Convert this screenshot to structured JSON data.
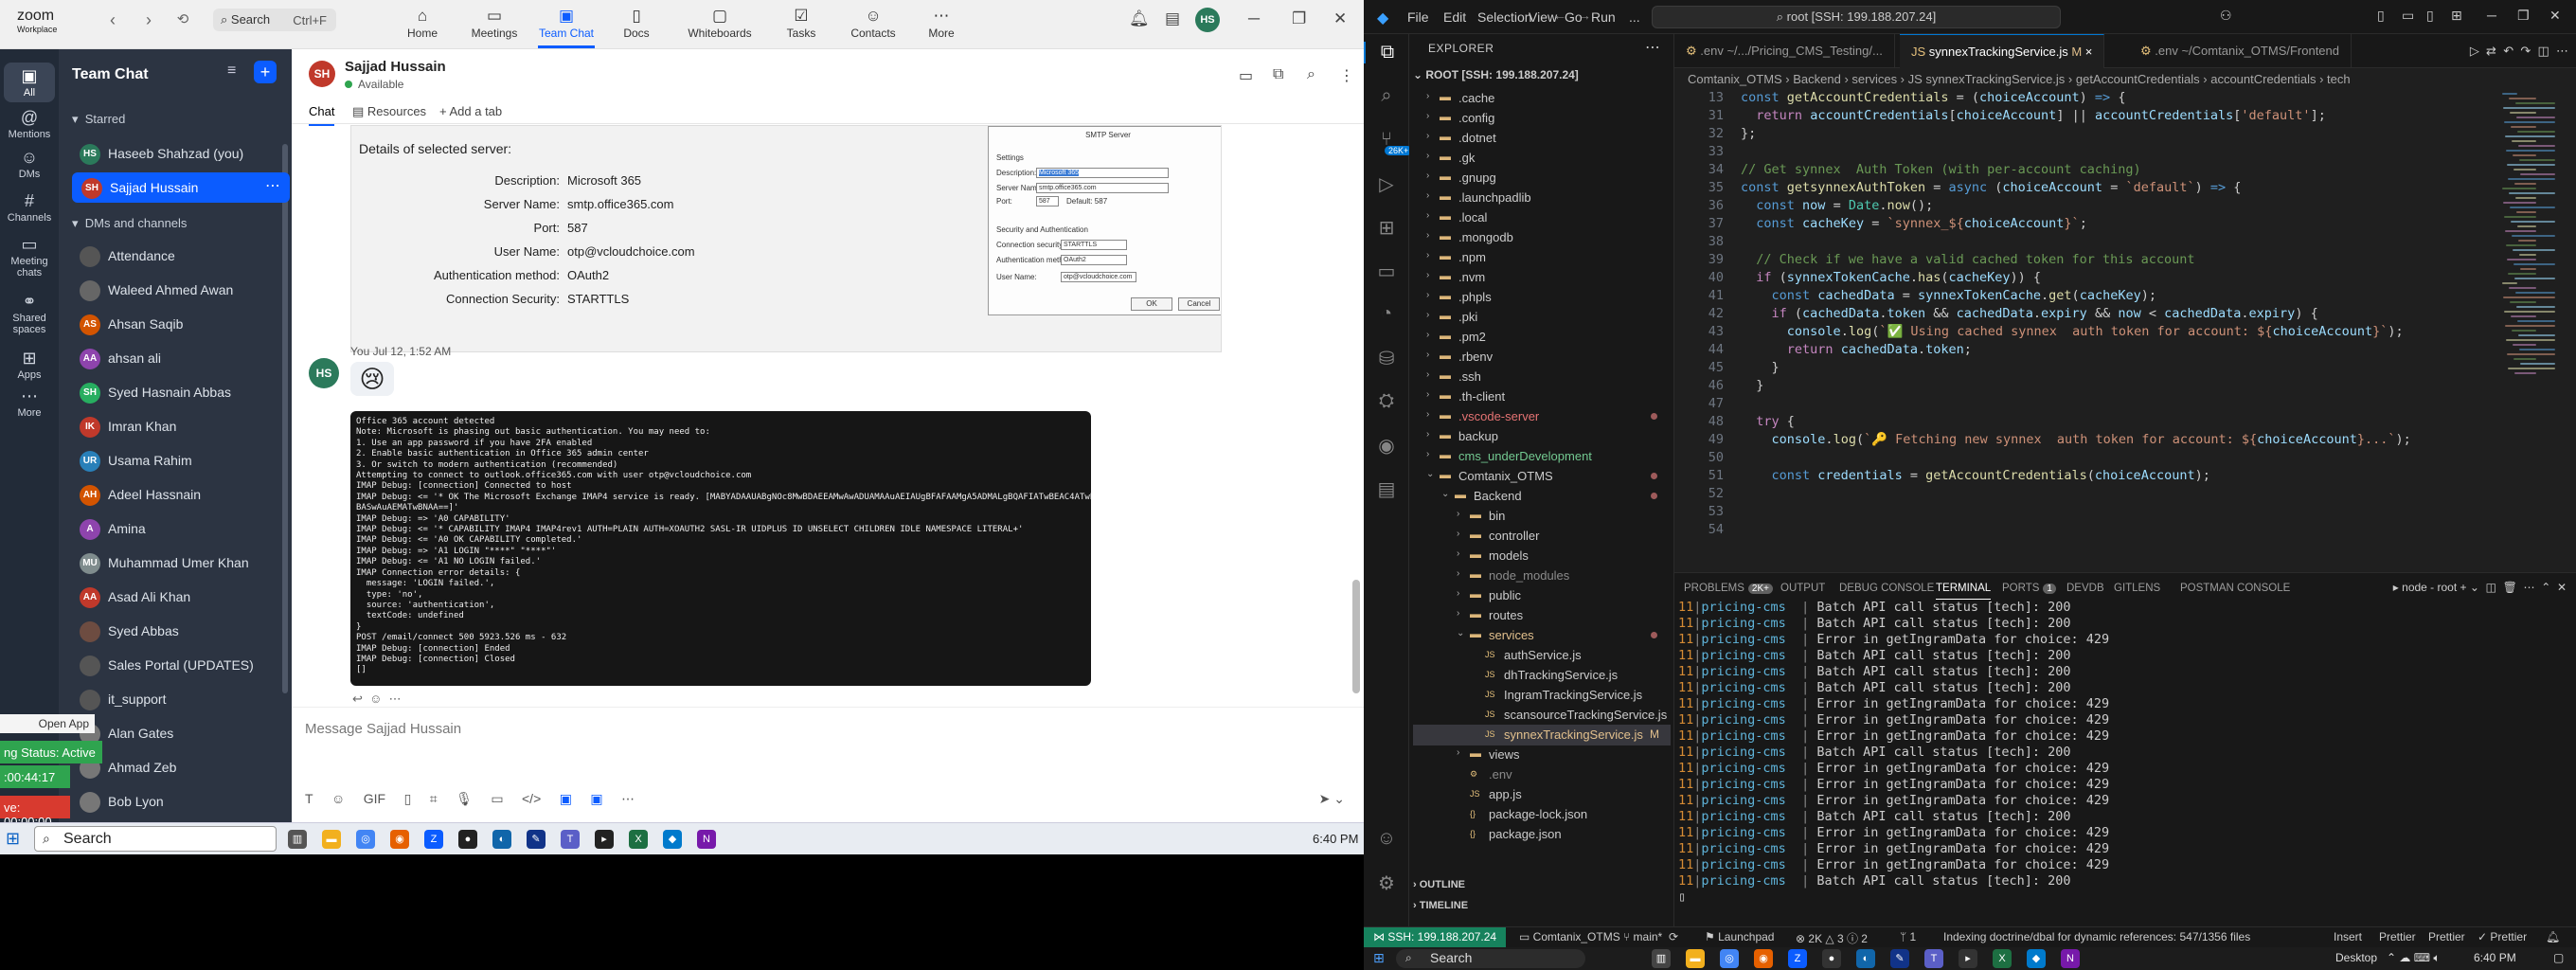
{
  "zoom": {
    "logo_top": "zoom",
    "logo_bottom": "Workplace",
    "search_label": "Search",
    "search_shortcut": "Ctrl+F",
    "tabs": [
      {
        "label": "Home",
        "icon": "home-icon"
      },
      {
        "label": "Meetings",
        "icon": "meetings-icon"
      },
      {
        "label": "Team Chat",
        "icon": "chat-icon"
      },
      {
        "label": "Docs",
        "icon": "docs-icon"
      },
      {
        "label": "Whiteboards",
        "icon": "whiteboard-icon"
      },
      {
        "label": "Tasks",
        "icon": "tasks-icon"
      },
      {
        "label": "Contacts",
        "icon": "contacts-icon"
      },
      {
        "label": "More",
        "icon": "more-icon"
      }
    ],
    "user_initials": "HS",
    "rail": [
      {
        "label": "All"
      },
      {
        "label": "Mentions"
      },
      {
        "label": "DMs"
      },
      {
        "label": "Channels"
      },
      {
        "label": "Meeting chats"
      },
      {
        "label": "Shared spaces"
      },
      {
        "label": "Apps"
      },
      {
        "label": "More"
      }
    ],
    "panel": {
      "title": "Team Chat",
      "starred_label": "Starred",
      "dms_label": "DMs and channels",
      "contacts": [
        {
          "name": "Haseeb Shahzad (you)",
          "initials": "HS",
          "color": "#2b7a5b"
        },
        {
          "name": "Sajjad Hussain",
          "initials": "SH",
          "color": "#c0392b"
        },
        {
          "name": "Attendance",
          "initials": "",
          "color": "#555"
        },
        {
          "name": "Waleed Ahmed Awan",
          "initials": "",
          "color": "#666"
        },
        {
          "name": "Ahsan Saqib",
          "initials": "AS",
          "color": "#d35400"
        },
        {
          "name": "ahsan ali",
          "initials": "AA",
          "color": "#8e44ad"
        },
        {
          "name": "Syed Hasnain Abbas",
          "initials": "SH",
          "color": "#27ae60"
        },
        {
          "name": "Imran Khan",
          "initials": "IK",
          "color": "#c0392b"
        },
        {
          "name": "Usama Rahim",
          "initials": "UR",
          "color": "#2980b9"
        },
        {
          "name": "Adeel Hassnain",
          "initials": "AH",
          "color": "#d35400"
        },
        {
          "name": "Amina",
          "initials": "A",
          "color": "#8e44ad"
        },
        {
          "name": "Muhammad Umer Khan",
          "initials": "MU",
          "color": "#7f8c8d"
        },
        {
          "name": "Asad Ali Khan",
          "initials": "AA",
          "color": "#c0392b"
        },
        {
          "name": "Syed Abbas",
          "initials": "",
          "color": "#6d4c41"
        },
        {
          "name": "Sales Portal (UPDATES)",
          "initials": "",
          "color": "#555"
        },
        {
          "name": "it_support",
          "initials": "",
          "color": "#555"
        },
        {
          "name": "Alan Gates",
          "initials": "",
          "color": "#777"
        },
        {
          "name": "Ahmad Zeb",
          "initials": "",
          "color": "#777"
        },
        {
          "name": "Bob Lyon",
          "initials": "",
          "color": "#777"
        }
      ]
    },
    "floats": {
      "open_app": "Open App",
      "status": "ng Status: Active",
      "time": ":00:44:17",
      "live": "ve: 00:00:00"
    },
    "chat": {
      "name": "Sajjad Hussain",
      "initials": "SH",
      "status": "Available",
      "tabs": [
        "Chat",
        "Resources",
        "+ Add a tab"
      ],
      "details_title": "Details of selected server:",
      "details": [
        {
          "k": "Description:",
          "v": "Microsoft 365"
        },
        {
          "k": "Server Name:",
          "v": "smtp.office365.com"
        },
        {
          "k": "Port:",
          "v": "587"
        },
        {
          "k": "User Name:",
          "v": "otp@vcloudchoice.com"
        },
        {
          "k": "Authentication method:",
          "v": "OAuth2"
        },
        {
          "k": "Connection Security:",
          "v": "STARTTLS"
        }
      ],
      "dialog": {
        "title": "SMTP Server",
        "settings": "Settings",
        "desc_label": "Description:",
        "desc_value": "Microsoft 365",
        "server_label": "Server Name:",
        "server_value": "smtp.office365.com",
        "port_label": "Port:",
        "port_value": "587",
        "default_label": "Default: 587",
        "security_title": "Security and Authentication",
        "conn_label": "Connection security:",
        "conn_value": "STARTTLS",
        "auth_label": "Authentication method:",
        "auth_value": "OAuth2",
        "user_label": "User Name:",
        "user_value": "otp@vcloudchoice.com",
        "ok": "OK",
        "cancel": "Cancel"
      },
      "msg_meta": "You  Jul 12, 1:52 AM",
      "my_initials": "HS",
      "emoji": "😢",
      "terminal_lines": [
        "Office 365 account detected",
        "Note: Microsoft is phasing out basic authentication. You may need to:",
        "1. Use an app password if you have 2FA enabled",
        "2. Enable basic authentication in Office 365 admin center",
        "3. Or switch to modern authentication (recommended)",
        "Attempting to connect to outlook.office365.com with user otp@vcloudchoice.com",
        "IMAP Debug: [connection] Connected to host",
        "IMAP Debug: <= '* OK The Microsoft Exchange IMAP4 service is ready. [MABYADAAUABgNOc8MwBDAEEAMwAwADUAMAAuAEIAUgBFAFAAMgA5ADMALgBQAFIATwBEAC4ATwBVAFQATABPAE",
        "BASwAuAEMATwBNAA==]'",
        "IMAP Debug: => 'A0 CAPABILITY'",
        "IMAP Debug: <= '* CAPABILITY IMAP4 IMAP4rev1 AUTH=PLAIN AUTH=XOAUTH2 SASL-IR UIDPLUS ID UNSELECT CHILDREN IDLE NAMESPACE LITERAL+'",
        "IMAP Debug: <= 'A0 OK CAPABILITY completed.'",
        "IMAP Debug: => 'A1 LOGIN \"****\" \"****\"'",
        "IMAP Debug: <= 'A1 NO LOGIN failed.'",
        "IMAP Connection error details: {",
        "  message: 'LOGIN failed.',",
        "  type: 'no',",
        "  source: 'authentication',",
        "  textCode: undefined",
        "}",
        "POST /email/connect 500 5923.526 ms - 632",
        "IMAP Debug: [connection] Ended",
        "IMAP Debug: [connection] Closed",
        "[]"
      ],
      "compose_placeholder": "Message Sajjad Hussain"
    },
    "taskbar": {
      "search": "Search",
      "time": "6:40 PM"
    }
  },
  "vscode": {
    "menu": [
      "File",
      "Edit",
      "Selection",
      "View",
      "Go",
      "Run",
      "..."
    ],
    "title": "root [SSH: 199.188.207.24]",
    "explorer_title": "EXPLORER",
    "root": "ROOT [SSH: 199.188.207.24]",
    "tree": [
      {
        "name": ".cache",
        "d": 0,
        "t": "f"
      },
      {
        "name": ".config",
        "d": 0,
        "t": "f"
      },
      {
        "name": ".dotnet",
        "d": 0,
        "t": "f"
      },
      {
        "name": ".gk",
        "d": 0,
        "t": "f"
      },
      {
        "name": ".gnupg",
        "d": 0,
        "t": "f"
      },
      {
        "name": ".launchpadlib",
        "d": 0,
        "t": "f"
      },
      {
        "name": ".local",
        "d": 0,
        "t": "f"
      },
      {
        "name": ".mongodb",
        "d": 0,
        "t": "f"
      },
      {
        "name": ".npm",
        "d": 0,
        "t": "f"
      },
      {
        "name": ".nvm",
        "d": 0,
        "t": "f"
      },
      {
        "name": ".phpls",
        "d": 0,
        "t": "f"
      },
      {
        "name": ".pki",
        "d": 0,
        "t": "f"
      },
      {
        "name": ".pm2",
        "d": 0,
        "t": "f"
      },
      {
        "name": ".rbenv",
        "d": 0,
        "t": "f"
      },
      {
        "name": ".ssh",
        "d": 0,
        "t": "f"
      },
      {
        "name": ".th-client",
        "d": 0,
        "t": "f"
      },
      {
        "name": ".vscode-server",
        "d": 0,
        "t": "f",
        "dot": true,
        "color": "#e57373"
      },
      {
        "name": "backup",
        "d": 0,
        "t": "f"
      },
      {
        "name": "cms_underDevelopment",
        "d": 0,
        "t": "f",
        "color": "#73c991"
      },
      {
        "name": "Comtanix_OTMS",
        "d": 0,
        "t": "o",
        "dot": true
      },
      {
        "name": "Backend",
        "d": 1,
        "t": "o",
        "dot": true
      },
      {
        "name": "bin",
        "d": 2,
        "t": "f"
      },
      {
        "name": "controller",
        "d": 2,
        "t": "f"
      },
      {
        "name": "models",
        "d": 2,
        "t": "f"
      },
      {
        "name": "node_modules",
        "d": 2,
        "t": "f",
        "color": "#8b8b8b"
      },
      {
        "name": "public",
        "d": 2,
        "t": "f"
      },
      {
        "name": "routes",
        "d": 2,
        "t": "f"
      },
      {
        "name": "services",
        "d": 2,
        "t": "o",
        "dot": true,
        "color": "#e2c08d"
      },
      {
        "name": "authService.js",
        "d": 3,
        "t": "js"
      },
      {
        "name": "dhTrackingService.js",
        "d": 3,
        "t": "js"
      },
      {
        "name": "IngramTrackingService.js",
        "d": 3,
        "t": "js"
      },
      {
        "name": "scansourceTrackingService.js",
        "d": 3,
        "t": "js"
      },
      {
        "name": "synnexTrackingService.js",
        "d": 3,
        "t": "js",
        "sel": true,
        "mod": "M",
        "color": "#e2c08d"
      },
      {
        "name": "views",
        "d": 2,
        "t": "f"
      },
      {
        "name": ".env",
        "d": 2,
        "t": "env",
        "color": "#8b8b8b"
      },
      {
        "name": "app.js",
        "d": 2,
        "t": "js"
      },
      {
        "name": "package-lock.json",
        "d": 2,
        "t": "json"
      },
      {
        "name": "package.json",
        "d": 2,
        "t": "json"
      }
    ],
    "outline": "OUTLINE",
    "timeline": "TIMELINE",
    "tabs": [
      {
        "label": ".env ~/.../Pricing_CMS_Testing/...",
        "active": false
      },
      {
        "label": "synnexTrackingService.js",
        "active": true,
        "mod": "M"
      },
      {
        "label": ".env ~/Comtanix_OTMS/Frontend",
        "active": false
      }
    ],
    "breadcrumbs": "Comtanix_OTMS  ›  Backend  ›  services  ›  JS synnexTrackingService.js  ›  getAccountCredentials  ›  accountCredentials  ›  tech",
    "code": [
      {
        "n": "13",
        "h": "<span class='kw'>const</span> <span class='fn'>getAccountCredentials</span> = (<span class='var'>choiceAccount</span>) <span class='kw'>=&gt;</span> {"
      },
      {
        "n": "31",
        "h": "  <span class='kw2'>return</span> <span class='var'>accountCredentials</span>[<span class='var'>choiceAccount</span>] || <span class='var'>accountCredentials</span>[<span class='str'>'default'</span>];"
      },
      {
        "n": "32",
        "h": "};"
      },
      {
        "n": "33",
        "h": ""
      },
      {
        "n": "34",
        "h": "<span class='cm'>// Get synnex  Auth Token (with per-account caching)</span>"
      },
      {
        "n": "35",
        "h": "<span class='kw'>const</span> <span class='fn'>getsynnexAuthToken</span> = <span class='kw'>async</span> (<span class='var'>choiceAccount</span> = <span class='str'>`default`</span>) <span class='kw'>=&gt;</span> {"
      },
      {
        "n": "36",
        "h": "  <span class='kw'>const</span> <span class='var'>now</span> = <span class='cls'>Date</span>.<span class='fn'>now</span>();"
      },
      {
        "n": "37",
        "h": "  <span class='kw'>const</span> <span class='var'>cacheKey</span> = <span class='str'>`synnex_${</span><span class='var'>choiceAccount</span><span class='str'>}`</span>;"
      },
      {
        "n": "38",
        "h": ""
      },
      {
        "n": "39",
        "h": "  <span class='cm'>// Check if we have a valid cached token for this account</span>"
      },
      {
        "n": "40",
        "h": "  <span class='kw2'>if</span> (<span class='var'>synnexTokenCache</span>.<span class='fn'>has</span>(<span class='var'>cacheKey</span>)) {"
      },
      {
        "n": "41",
        "h": "    <span class='kw'>const</span> <span class='var'>cachedData</span> = <span class='var'>synnexTokenCache</span>.<span class='fn'>get</span>(<span class='var'>cacheKey</span>);"
      },
      {
        "n": "42",
        "h": "    <span class='kw2'>if</span> (<span class='var'>cachedData</span>.<span class='var'>token</span> &amp;&amp; <span class='var'>cachedData</span>.<span class='var'>expiry</span> &amp;&amp; <span class='var'>now</span> &lt; <span class='var'>cachedData</span>.<span class='var'>expiry</span>) {"
      },
      {
        "n": "43",
        "h": "      <span class='var'>console</span>.<span class='fn'>log</span>(<span class='str'>`✅ Using cached synnex  auth token for account: ${</span><span class='var'>choiceAccount</span><span class='str'>}`</span>);"
      },
      {
        "n": "44",
        "h": "      <span class='kw2'>return</span> <span class='var'>cachedData</span>.<span class='var'>token</span>;"
      },
      {
        "n": "45",
        "h": "    }"
      },
      {
        "n": "46",
        "h": "  }"
      },
      {
        "n": "47",
        "h": ""
      },
      {
        "n": "48",
        "h": "  <span class='kw2'>try</span> {"
      },
      {
        "n": "49",
        "h": "    <span class='var'>console</span>.<span class='fn'>log</span>(<span class='str'>`🔑 Fetching new synnex  auth token for account: ${</span><span class='var'>choiceAccount</span><span class='str'>}...`</span>);"
      },
      {
        "n": "50",
        "h": ""
      },
      {
        "n": "51",
        "h": "    <span class='kw'>const</span> <span class='var'>credentials</span> = <span class='fn'>getAccountCredentials</span>(<span class='var'>choiceAccount</span>);"
      },
      {
        "n": "52",
        "h": ""
      },
      {
        "n": "53",
        "h": ""
      },
      {
        "n": "54",
        "h": ""
      }
    ],
    "panel_tabs": [
      {
        "label": "PROBLEMS",
        "badge": "2K+"
      },
      {
        "label": "OUTPUT"
      },
      {
        "label": "DEBUG CONSOLE"
      },
      {
        "label": "TERMINAL",
        "active": true
      },
      {
        "label": "PORTS",
        "badge": "1"
      },
      {
        "label": "DEVDB"
      },
      {
        "label": "GITLENS"
      },
      {
        "label": "POSTMAN CONSOLE"
      }
    ],
    "panel_right": "node - root",
    "term": [
      {
        "id": "11",
        "svc": "pricing-cms",
        "msg": "Batch API call status [tech]: 200"
      },
      {
        "id": "11",
        "svc": "pricing-cms",
        "msg": "Batch API call status [tech]: 200"
      },
      {
        "id": "11",
        "svc": "pricing-cms",
        "msg": "Error in getIngramData for choice: 429"
      },
      {
        "id": "11",
        "svc": "pricing-cms",
        "msg": "Batch API call status [tech]: 200"
      },
      {
        "id": "11",
        "svc": "pricing-cms",
        "msg": "Batch API call status [tech]: 200"
      },
      {
        "id": "11",
        "svc": "pricing-cms",
        "msg": "Batch API call status [tech]: 200"
      },
      {
        "id": "11",
        "svc": "pricing-cms",
        "msg": "Error in getIngramData for choice: 429"
      },
      {
        "id": "11",
        "svc": "pricing-cms",
        "msg": "Error in getIngramData for choice: 429"
      },
      {
        "id": "11",
        "svc": "pricing-cms",
        "msg": "Error in getIngramData for choice: 429"
      },
      {
        "id": "11",
        "svc": "pricing-cms",
        "msg": "Batch API call status [tech]: 200"
      },
      {
        "id": "11",
        "svc": "pricing-cms",
        "msg": "Error in getIngramData for choice: 429"
      },
      {
        "id": "11",
        "svc": "pricing-cms",
        "msg": "Error in getIngramData for choice: 429"
      },
      {
        "id": "11",
        "svc": "pricing-cms",
        "msg": "Error in getIngramData for choice: 429"
      },
      {
        "id": "11",
        "svc": "pricing-cms",
        "msg": "Batch API call status [tech]: 200"
      },
      {
        "id": "11",
        "svc": "pricing-cms",
        "msg": "Error in getIngramData for choice: 429"
      },
      {
        "id": "11",
        "svc": "pricing-cms",
        "msg": "Error in getIngramData for choice: 429"
      },
      {
        "id": "11",
        "svc": "pricing-cms",
        "msg": "Error in getIngramData for choice: 429"
      },
      {
        "id": "11",
        "svc": "pricing-cms",
        "msg": "Batch API call status [tech]: 200"
      }
    ],
    "status": {
      "remote": "SSH: 199.188.207.24",
      "branch_dir": "Comtanix_OTMS",
      "branch": "main*",
      "sync": "⟳",
      "launchpad": "Launchpad",
      "problems": "⊗ 2K  △ 3  ⓘ 2",
      "ports": "ᛘ 1",
      "indexing": "Indexing doctrine/dbal for dynamic references: 547/1356 files",
      "insert": "Insert",
      "prettier1": "Prettier",
      "prettier2": "Prettier",
      "prettier3": "✓ Prettier"
    },
    "taskbar": {
      "search": "Search",
      "desktop": "Desktop",
      "time": "6:40 PM"
    }
  }
}
